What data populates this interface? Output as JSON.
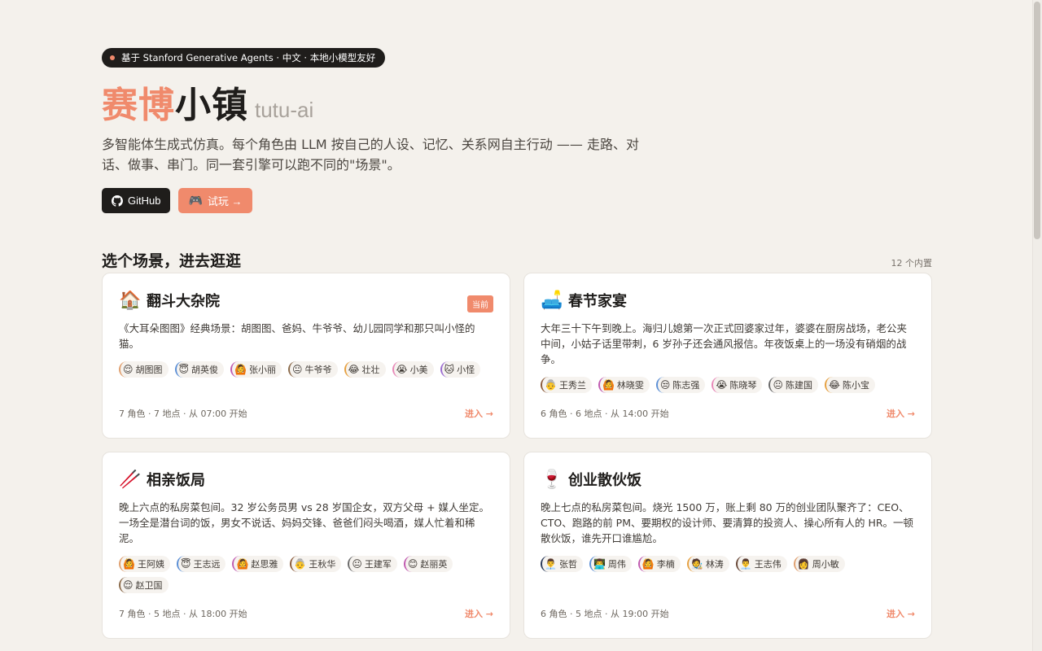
{
  "hero": {
    "badge": "基于 Stanford Generative Agents · 中文 · 本地小模型友好",
    "title_accent": "赛博",
    "title_main": "小镇",
    "title_sub": "tutu-ai",
    "description": "多智能体生成式仿真。每个角色由 LLM 按自己的人设、记忆、关系网自主行动 —— 走路、对话、做事、串门。同一套引擎可以跑不同的\"场景\"。",
    "github_label": "GitHub",
    "play_label": "试玩 →"
  },
  "section": {
    "title": "选个场景，进去逛逛",
    "count": "12 个内置"
  },
  "colors": {
    "accent": "#f08a6c",
    "dark": "#1f1d1b"
  },
  "scenes": [
    {
      "emoji": "🏠",
      "title": "翻斗大杂院",
      "current": "当前",
      "desc": "《大耳朵图图》经典场景：胡图图、爸妈、牛爷爷、幼儿园同学和那只叫小怪的猫。",
      "chars": [
        {
          "face": "😌",
          "name": "胡图图"
        },
        {
          "face": "😇",
          "name": "胡英俊"
        },
        {
          "face": "🙆",
          "name": "张小丽"
        },
        {
          "face": "😐",
          "name": "牛爷爷"
        },
        {
          "face": "😂",
          "name": "壮壮"
        },
        {
          "face": "😭",
          "name": "小美"
        },
        {
          "face": "🐱",
          "name": "小怪"
        }
      ],
      "meta": "7 角色 · 7 地点 · 从 07:00 开始",
      "enter": "进入 →"
    },
    {
      "emoji": "🛋️",
      "title": "春节家宴",
      "current": "",
      "desc": "大年三十下午到晚上。海归儿媳第一次正式回婆家过年，婆婆在厨房战场，老公夹中间，小姑子话里带刺，6 岁孙子还会通风报信。年夜饭桌上的一场没有硝烟的战争。",
      "chars": [
        {
          "face": "👵",
          "name": "王秀兰"
        },
        {
          "face": "🙆",
          "name": "林晓雯"
        },
        {
          "face": "😒",
          "name": "陈志强"
        },
        {
          "face": "😭",
          "name": "陈晓琴"
        },
        {
          "face": "😐",
          "name": "陈建国"
        },
        {
          "face": "😂",
          "name": "陈小宝"
        }
      ],
      "meta": "6 角色 · 6 地点 · 从 14:00 开始",
      "enter": "进入 →"
    },
    {
      "emoji": "🥢",
      "title": "相亲饭局",
      "current": "",
      "desc": "晚上六点的私房菜包间。32 岁公务员男 vs 28 岁国企女，双方父母 + 媒人坐定。一场全是潜台词的饭，男女不说话、妈妈交锋、爸爸们闷头喝酒，媒人忙着和稀泥。",
      "chars": [
        {
          "face": "🙆",
          "name": "王阿姨"
        },
        {
          "face": "😇",
          "name": "王志远"
        },
        {
          "face": "🙆",
          "name": "赵思雅"
        },
        {
          "face": "👵",
          "name": "王秋华"
        },
        {
          "face": "😐",
          "name": "王建军"
        },
        {
          "face": "😊",
          "name": "赵丽英"
        },
        {
          "face": "😌",
          "name": "赵卫国"
        }
      ],
      "meta": "7 角色 · 5 地点 · 从 18:00 开始",
      "enter": "进入 →"
    },
    {
      "emoji": "🍷",
      "title": "创业散伙饭",
      "current": "",
      "desc": "晚上七点的私房菜包间。烧光 1500 万，账上剩 80 万的创业团队聚齐了：CEO、CTO、跑路的前 PM、要期权的设计师、要清算的投资人、操心所有人的 HR。一顿散伙饭，谁先开口谁尴尬。",
      "chars": [
        {
          "face": "👨‍💼",
          "name": "张哲"
        },
        {
          "face": "👨‍💻",
          "name": "周伟"
        },
        {
          "face": "🙆",
          "name": "李楠"
        },
        {
          "face": "🧑‍🎨",
          "name": "林涛"
        },
        {
          "face": "👨‍💼",
          "name": "王志伟"
        },
        {
          "face": "👩",
          "name": "周小敏"
        }
      ],
      "meta": "6 角色 · 5 地点 · 从 19:00 开始",
      "enter": "进入 →"
    }
  ]
}
